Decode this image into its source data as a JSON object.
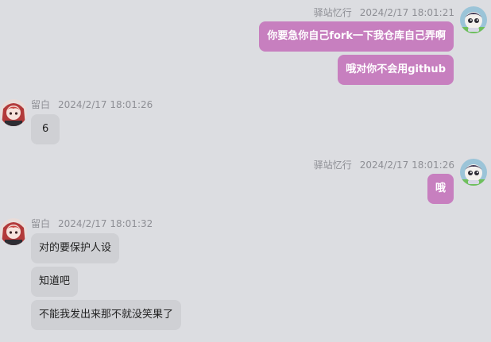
{
  "colors": {
    "background": "#dcdde1",
    "self_bubble": "#c77fbf",
    "other_bubble": "#cfd0d4",
    "meta_text": "#8e8f95"
  },
  "messages": [
    {
      "sender": "驿站忆行",
      "timestamp": "2024/2/17 18:01:21",
      "side": "right",
      "avatar_icon": "chibi-character-avatar-icon",
      "lines": [
        "你要急你自己fork一下我仓库自己弄啊",
        "哦对你不会用github"
      ]
    },
    {
      "sender": "留白",
      "timestamp": "2024/2/17 18:01:26",
      "side": "left",
      "avatar_icon": "anime-girl-avatar-icon",
      "lines": [
        "6"
      ]
    },
    {
      "sender": "驿站忆行",
      "timestamp": "2024/2/17 18:01:26",
      "side": "right",
      "avatar_icon": "chibi-character-avatar-icon",
      "lines": [
        "哦"
      ]
    },
    {
      "sender": "留白",
      "timestamp": "2024/2/17 18:01:32",
      "side": "left",
      "avatar_icon": "anime-girl-avatar-icon",
      "lines": [
        "对的要保护人设",
        "知道吧",
        "不能我发出来那不就没笑果了"
      ]
    }
  ]
}
